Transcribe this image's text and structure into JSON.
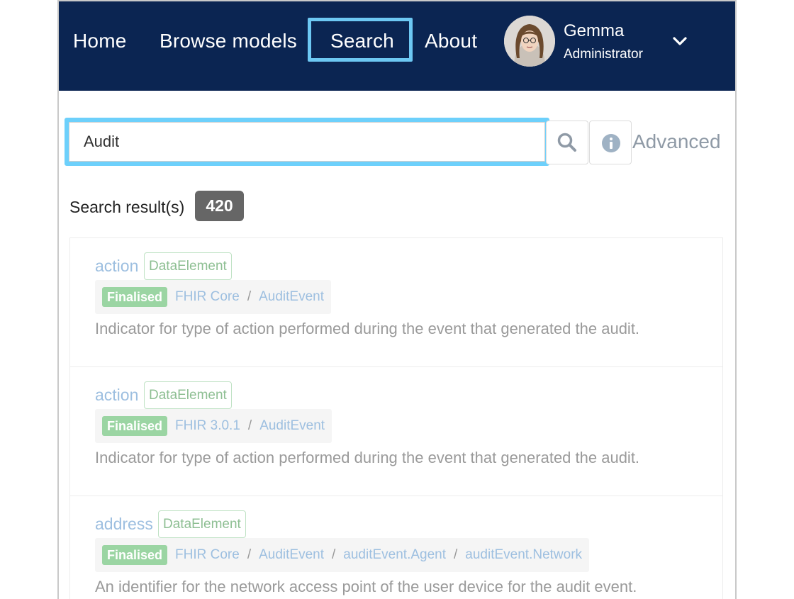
{
  "nav": {
    "home": "Home",
    "browse": "Browse models",
    "search": "Search",
    "about": "About",
    "user_name": "Gemma",
    "user_role": "Administrator"
  },
  "search": {
    "query": "Audit",
    "advanced_label": "Advanced"
  },
  "results_header": {
    "label": "Search result(s)",
    "count": "420"
  },
  "results": [
    {
      "title": "action",
      "type": "DataElement",
      "status": "Finalised",
      "path": [
        "FHIR Core",
        "AuditEvent"
      ],
      "description": "Indicator for type of action performed during the event that generated the audit."
    },
    {
      "title": "action",
      "type": "DataElement",
      "status": "Finalised",
      "path": [
        "FHIR 3.0.1",
        "AuditEvent"
      ],
      "description": "Indicator for type of action performed during the event that generated the audit."
    },
    {
      "title": "address",
      "type": "DataElement",
      "status": "Finalised",
      "path": [
        "FHIR Core",
        "AuditEvent",
        "auditEvent.Agent",
        "auditEvent.Network"
      ],
      "description": "An identifier for the network access point of the user device for the audit event."
    }
  ],
  "colors": {
    "navbar": "#0b2552",
    "highlight": "#6dc8f3",
    "link": "#9dbfe0",
    "finalised": "#9bd5a3",
    "count_badge": "#666666"
  },
  "icons": {
    "search_button": "search-icon",
    "info_button": "info-icon",
    "user_menu": "chevron-down-icon"
  }
}
